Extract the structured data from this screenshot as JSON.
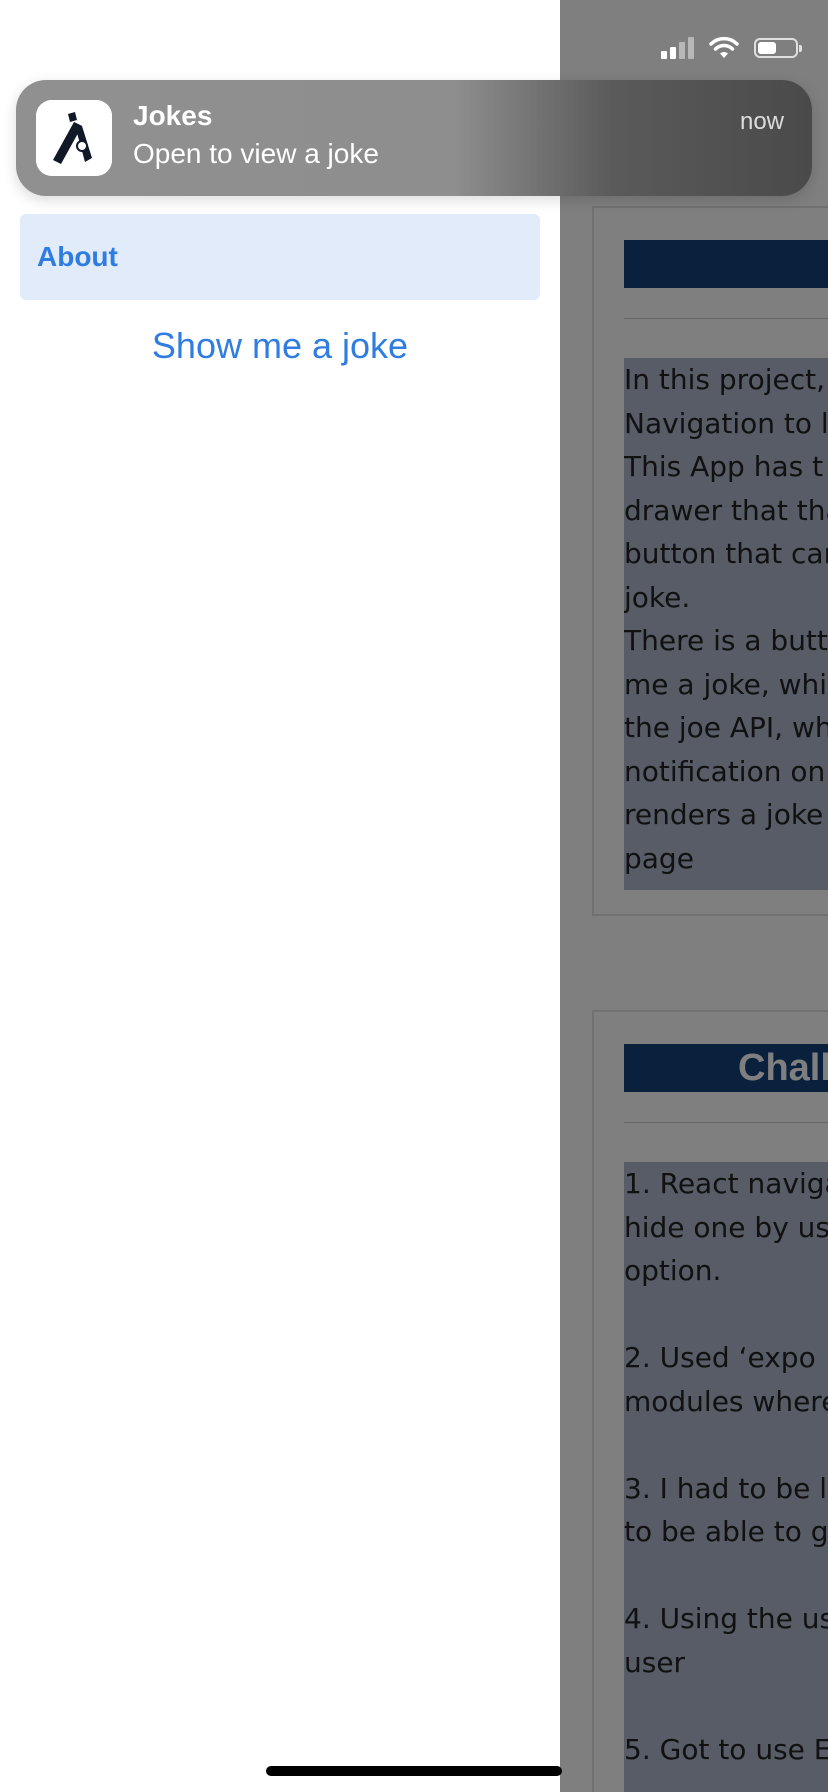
{
  "status_bar": {
    "signal_icon": "cellular-signal-icon",
    "wifi_icon": "wifi-icon",
    "battery_icon": "battery-icon",
    "battery_level": 0.5
  },
  "notification": {
    "app_name": "Jokes",
    "message": "Open to view a joke",
    "time": "now",
    "icon": "jokes-app-icon"
  },
  "drawer": {
    "items": [
      {
        "label": "About",
        "active": true
      }
    ],
    "show_joke_label": "Show me a joke"
  },
  "main": {
    "cards": [
      {
        "header": "",
        "body": "In this project,\nNavigation to l\nThis App has t\ndrawer that tha\nbutton that can\njoke.\nThere is a butt\nme a joke, whi\nthe joe API, wh\nnotification on\nrenders a joke\npage"
      },
      {
        "header": "Challen",
        "body": "1. React naviga\nhide one by us\noption.\n\n2. Used ‘expo\nmodules where\n\n3. I had to be l\nto be able to g\n\n4. Using the us\nuser\n\n5. Got to use E"
      }
    ]
  },
  "colors": {
    "accent": "#2f7de1",
    "drawer_active_bg": "#e1ebf9",
    "card_header_bg": "#13427a",
    "highlight_bg": "#aeb9cf"
  }
}
